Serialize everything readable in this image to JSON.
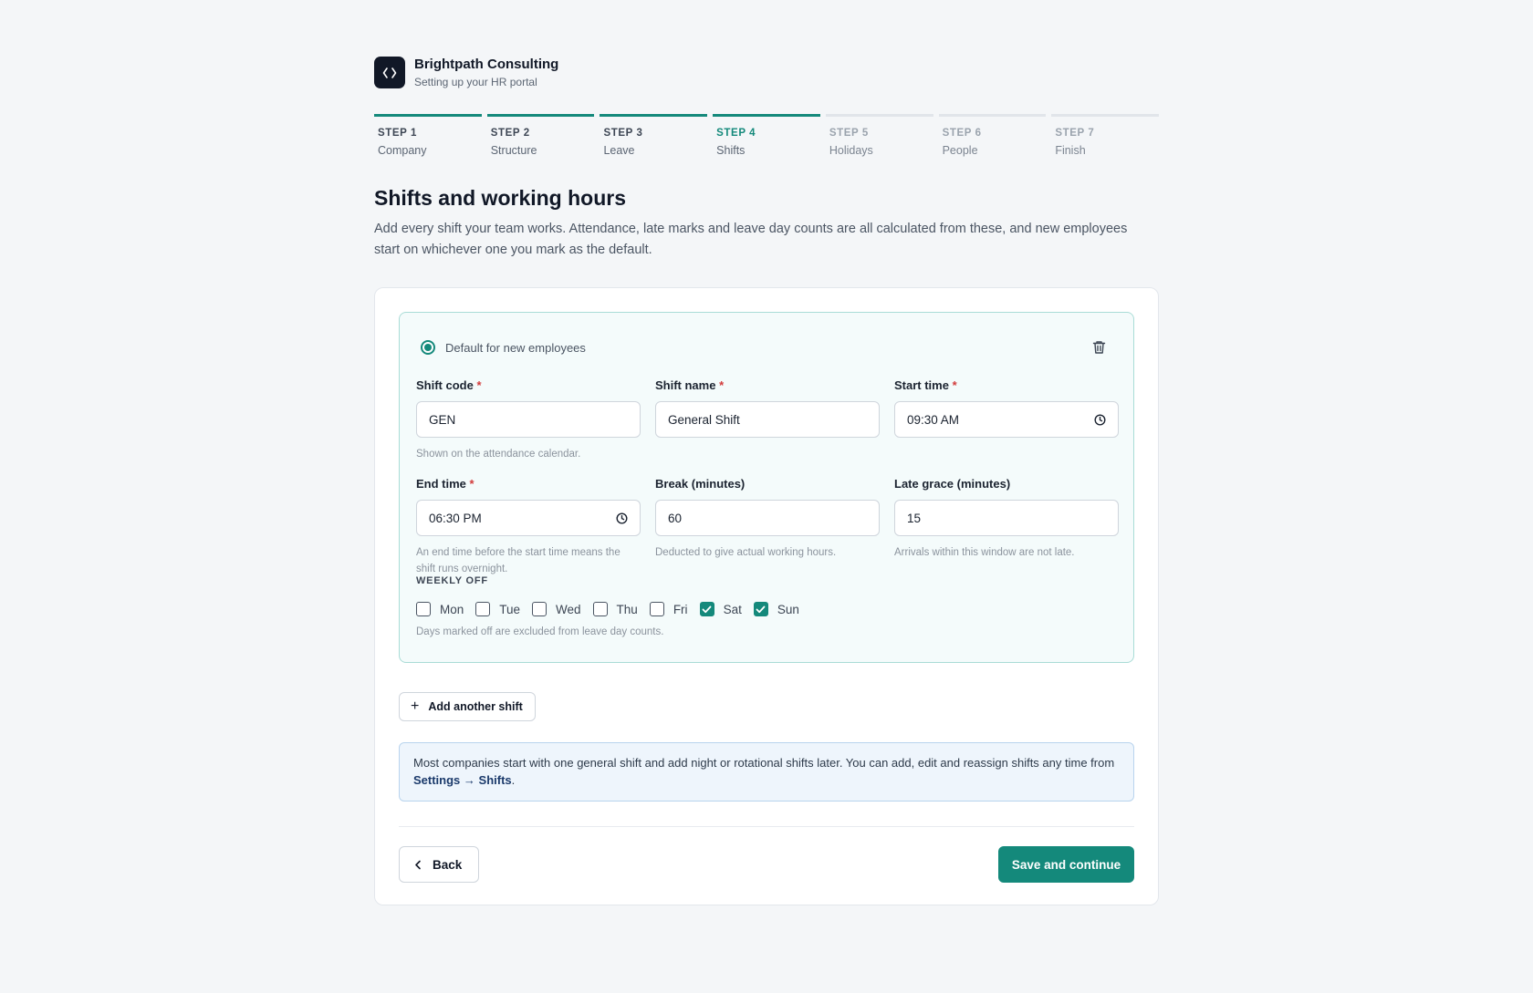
{
  "brand": {
    "name": "Brightpath Consulting",
    "subtitle": "Setting up your HR portal",
    "logo_icon": "code-brackets-icon"
  },
  "steps": [
    {
      "num": "STEP 1",
      "label": "Company",
      "state": "done"
    },
    {
      "num": "STEP 2",
      "label": "Structure",
      "state": "done"
    },
    {
      "num": "STEP 3",
      "label": "Leave",
      "state": "done"
    },
    {
      "num": "STEP 4",
      "label": "Shifts",
      "state": "active"
    },
    {
      "num": "STEP 5",
      "label": "Holidays",
      "state": "todo"
    },
    {
      "num": "STEP 6",
      "label": "People",
      "state": "todo"
    },
    {
      "num": "STEP 7",
      "label": "Finish",
      "state": "todo"
    }
  ],
  "page": {
    "title": "Shifts and working hours",
    "intro": "Add every shift your team works. Attendance, late marks and leave day counts are all calculated from these, and new employees start on whichever one you mark as the default."
  },
  "shift": {
    "default_label": "Default for new employees",
    "default_selected": true,
    "fields": {
      "code": {
        "label": "Shift code",
        "value": "GEN",
        "help": "Shown on the attendance calendar."
      },
      "name": {
        "label": "Shift name",
        "value": "General Shift"
      },
      "start": {
        "label": "Start time",
        "value": "09:30 AM"
      },
      "end": {
        "label": "End time",
        "value": "06:30 PM",
        "help": "An end time before the start time means the shift runs overnight."
      },
      "break": {
        "label": "Break (minutes)",
        "value": "60",
        "help": "Deducted to give actual working hours."
      },
      "grace": {
        "label": "Late grace (minutes)",
        "value": "15",
        "help": "Arrivals within this window are not late."
      }
    },
    "required_mark": "*",
    "weekly_off": {
      "title": "WEEKLY OFF",
      "days": [
        {
          "label": "Mon",
          "checked": false
        },
        {
          "label": "Tue",
          "checked": false
        },
        {
          "label": "Wed",
          "checked": false
        },
        {
          "label": "Thu",
          "checked": false
        },
        {
          "label": "Fri",
          "checked": false
        },
        {
          "label": "Sat",
          "checked": true
        },
        {
          "label": "Sun",
          "checked": true
        }
      ],
      "help": "Days marked off are excluded from leave day counts."
    }
  },
  "actions": {
    "add_shift": "Add another shift",
    "back": "Back",
    "save": "Save and continue"
  },
  "note": {
    "text": "Most companies start with one general shift and add night or rotational shifts later. You can add, edit and reassign shifts any time from ",
    "link_settings": "Settings",
    "arrow": "→",
    "link_shifts": "Shifts",
    "end": "."
  },
  "colors": {
    "accent": "#14897b",
    "required": "#d23b3b",
    "note_bg": "#eef5fc"
  }
}
